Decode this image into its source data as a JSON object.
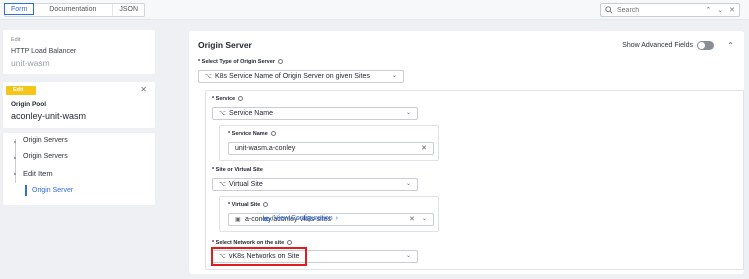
{
  "topbar": {
    "tabs": [
      {
        "label": "Form",
        "active": true
      },
      {
        "label": "Documentation",
        "active": false
      },
      {
        "label": "JSON",
        "active": false
      }
    ],
    "search_placeholder": "Search"
  },
  "edit_card": {
    "label": "Edit",
    "title": "HTTP Load Balancer",
    "name": "unit-wasm"
  },
  "pool_card": {
    "badge": "Edit",
    "title": "Origin Pool",
    "name": "aconley-unit-wasm"
  },
  "tree": {
    "items": [
      "Origin Servers",
      "Origin Servers",
      "Edit Item"
    ],
    "sub_item": "Origin Server"
  },
  "main": {
    "title": "Origin Server",
    "advanced_label": "Show Advanced Fields",
    "type_label": "Select Type of Origin Server",
    "type_value": "K8s Service Name of Origin Server on given Sites",
    "service_label": "Service",
    "service_value": "Service Name",
    "service_name_label": "Service Name",
    "service_name_value": "unit-wasm.a-conley",
    "site_label": "Site or Virtual Site",
    "site_value": "Virtual Site",
    "virtual_site_label": "Virtual Site",
    "virtual_site_value": "a-conley/aconley-vk8s-sites",
    "view_config": "View Configuration",
    "network_label": "Select Network on the site",
    "network_value": "vK8s Networks on Site"
  },
  "colors": {
    "accent": "#2f6fdb",
    "badge": "#f5c518",
    "highlight": "#e11d1d"
  }
}
